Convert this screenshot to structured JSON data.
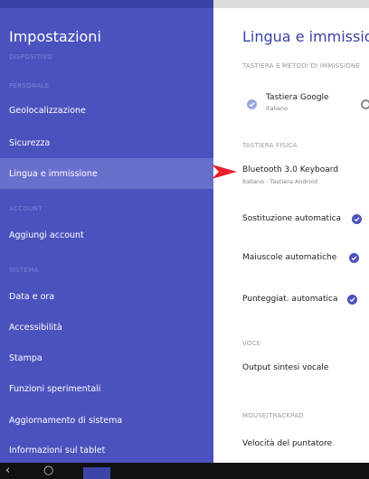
{
  "sidebar": {
    "title": "Impostazioni",
    "sections": {
      "dispositivo": "DISPOSITIVO",
      "personale": "PERSONALE",
      "account": "ACCOUNT",
      "sistema": "SISTEMA"
    },
    "items": [
      "Geolocalizzazione",
      "Sicurezza",
      "Lingua e immissione",
      "Aggiungi account",
      "Data e ora",
      "Accessibilità",
      "Stampa",
      "Funzioni sperimentali",
      "Aggiornamento di sistema",
      "Informazioni sul tablet"
    ],
    "selected_index": 2
  },
  "detail": {
    "title": "Lingua e immissione",
    "sections": {
      "keyboard_methods": "TASTIERA E METODI DI IMMISSIONE",
      "physical": "TASTIERA FISICA",
      "voice": "VOCE",
      "mouse": "MOUSE/TRACKPAD"
    },
    "google_keyboard": {
      "name": "Tastiera Google",
      "lang": "Italiano"
    },
    "bluetooth_keyboard": {
      "name": "Bluetooth 3.0 Keyboard",
      "layout": "Italiano - Tastiera Android"
    },
    "toggles": [
      {
        "label": "Sostituzione automatica",
        "checked": true
      },
      {
        "label": "Maiuscole automatiche",
        "checked": true
      },
      {
        "label": "Punteggiat. automatica",
        "checked": true
      }
    ],
    "tts": "Output sintesi vocale",
    "pointer_speed": "Velocità del puntatore"
  },
  "colors": {
    "sidebar_bg": "#4b52bd",
    "sidebar_selected": "#6970cc",
    "accent": "#3a41a5",
    "arrow": "#e8202a"
  },
  "icons": {
    "check": "check-circle-icon",
    "settings": "gear-icon",
    "back": "back-icon",
    "home": "home-icon",
    "recents": "recents-icon"
  }
}
